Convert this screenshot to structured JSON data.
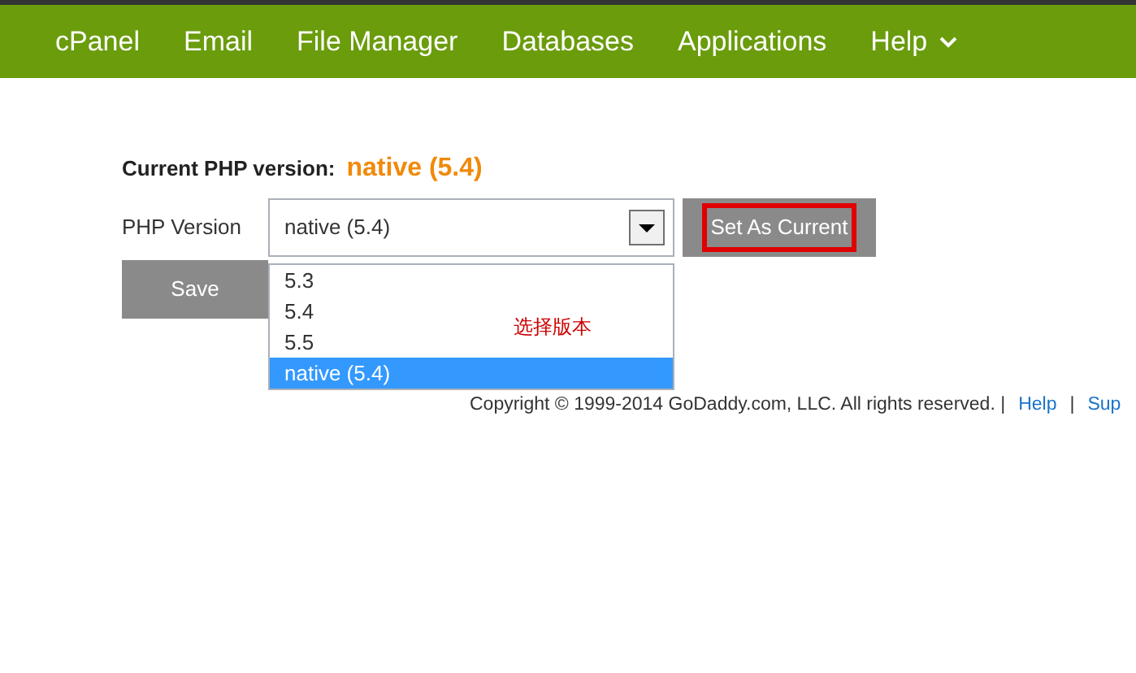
{
  "nav": {
    "items": [
      {
        "label": "cPanel",
        "kind": "link"
      },
      {
        "label": "Email",
        "kind": "link"
      },
      {
        "label": "File Manager",
        "kind": "link"
      },
      {
        "label": "Databases",
        "kind": "link"
      },
      {
        "label": "Applications",
        "kind": "link"
      },
      {
        "label": "Help",
        "kind": "menu"
      }
    ]
  },
  "current_version": {
    "label": "Current PHP version:",
    "value": "native (5.4)"
  },
  "php_version": {
    "label": "PHP Version",
    "value": "native (5.4)",
    "expanded": true,
    "options": [
      {
        "label": "5.3",
        "selected": false
      },
      {
        "label": "5.4",
        "selected": false
      },
      {
        "label": "5.5",
        "selected": false
      },
      {
        "label": "native (5.4)",
        "selected": true
      }
    ]
  },
  "set_current_button": {
    "label": "Set As Current",
    "highlighted": true
  },
  "save_button": "Save",
  "annotation": "选择版本",
  "footer": {
    "copyright": "Copyright © 1999-2014 GoDaddy.com, LLC. All rights reserved. |",
    "links": [
      "Help",
      "Sup"
    ],
    "separator": "|"
  }
}
